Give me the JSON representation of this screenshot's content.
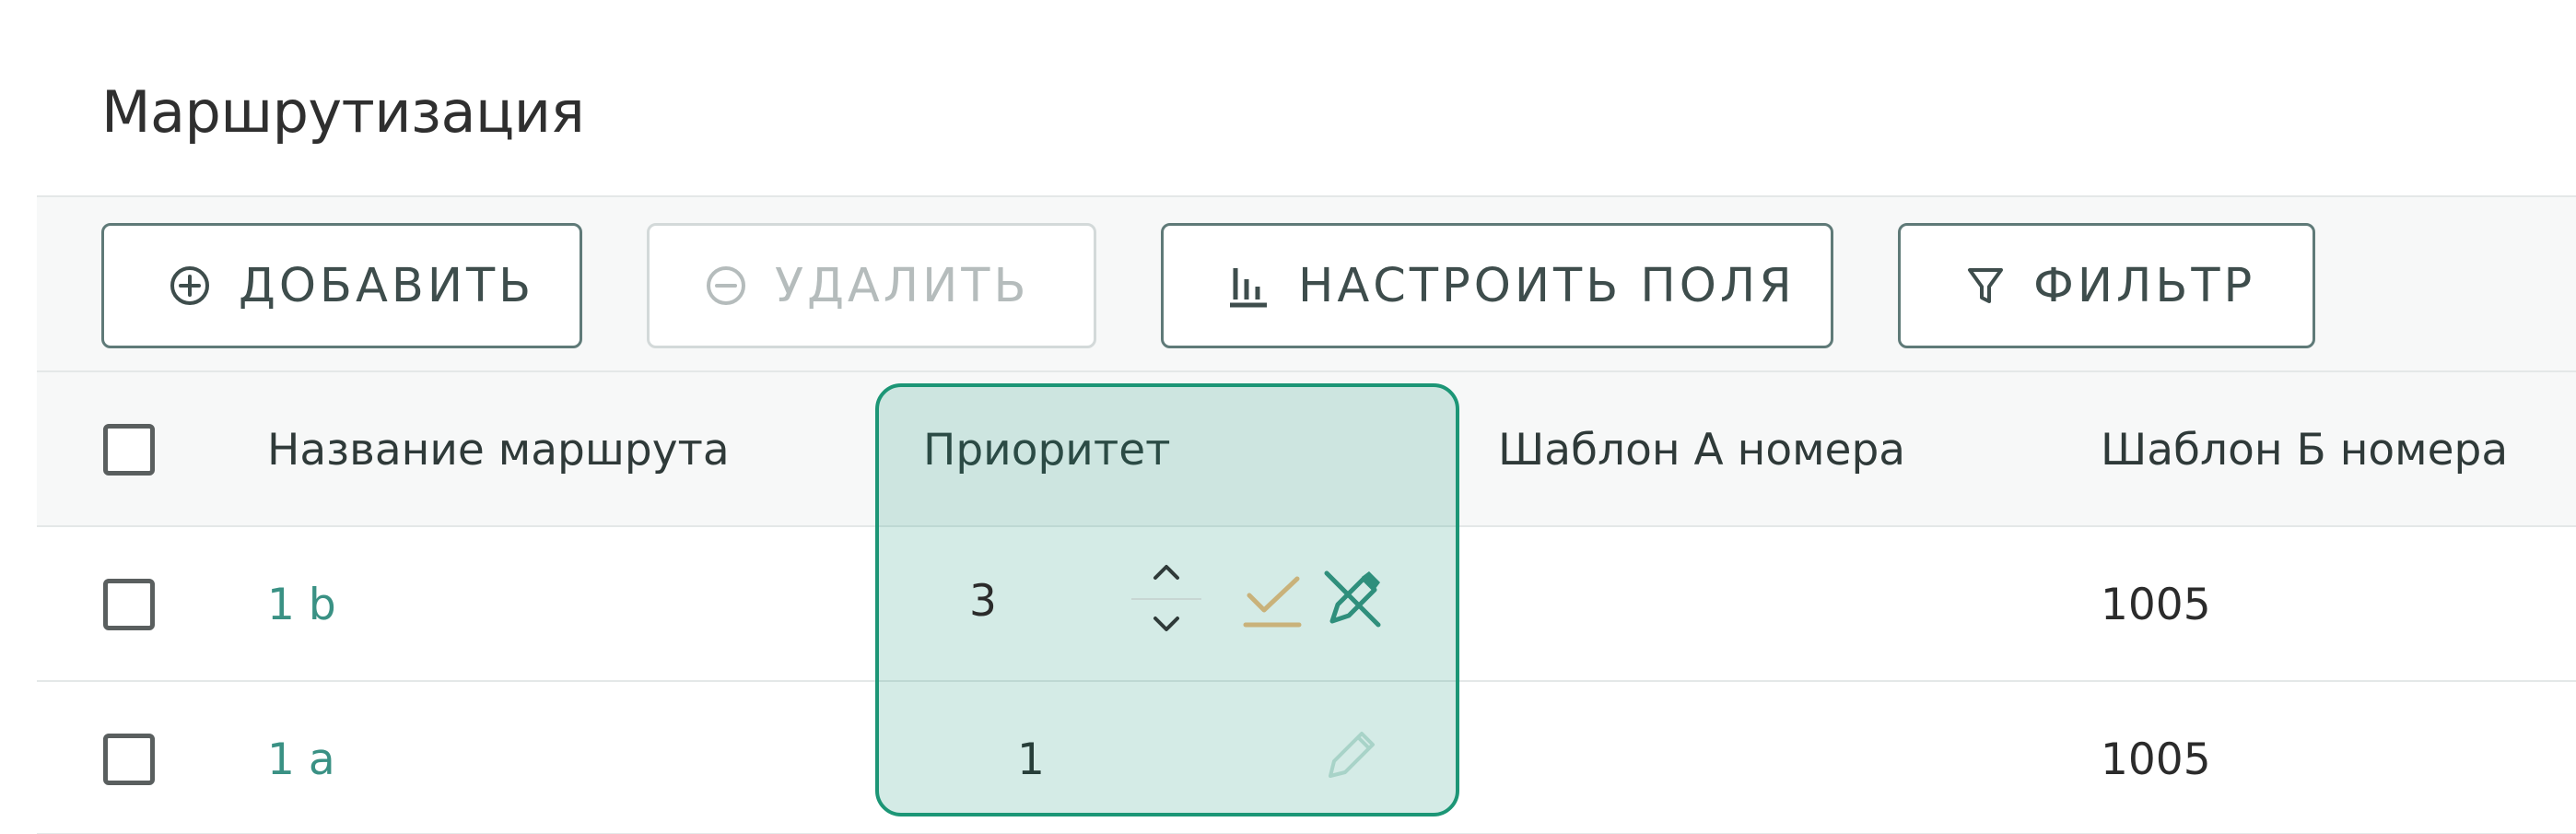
{
  "page": {
    "title": "Маршрутизация"
  },
  "toolbar": {
    "add_label": "Добавить",
    "delete_label": "Удалить",
    "columns_label": "Настроить поля",
    "filter_label": "Фильтр"
  },
  "table": {
    "headers": {
      "name": "Название маршрута",
      "priority": "Приоритет",
      "template_a": "Шаблон А номера",
      "template_b": "Шаблон Б номера"
    },
    "rows": [
      {
        "name": "1 b",
        "priority": "3",
        "template_a": "",
        "template_b": "1005",
        "editing": true
      },
      {
        "name": "1 a",
        "priority": "1",
        "template_a": "",
        "template_b": "1005",
        "editing": false
      }
    ]
  },
  "icons": {
    "add": "plus-circle-icon",
    "delete": "minus-circle-icon",
    "columns": "columns-icon",
    "filter": "filter-icon",
    "confirm": "check-icon",
    "cancel": "pencil-off-icon",
    "edit": "pencil-icon",
    "increment": "chevron-up-icon",
    "decrement": "chevron-down-icon"
  },
  "colors": {
    "accent": "#1c9676",
    "link": "#3a9184",
    "confirm": "#c9b27a",
    "border": "#5f7a78"
  }
}
